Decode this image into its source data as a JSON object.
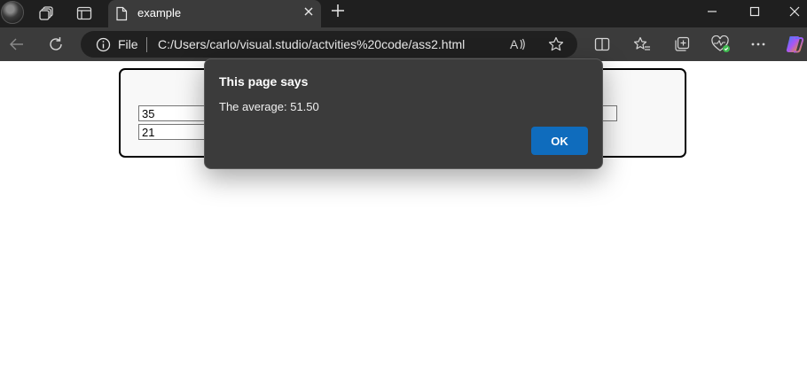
{
  "tab": {
    "title": "example"
  },
  "address_bar": {
    "scheme_label": "File",
    "url": "C:/Users/carlo/visual.studio/actvities%20code/ass2.html"
  },
  "page": {
    "inputs": {
      "first": "35",
      "second": "21",
      "right": ""
    }
  },
  "dialog": {
    "title": "This page says",
    "message": "The average: 51.50",
    "ok_label": "OK"
  },
  "colors": {
    "titlebar": "#1f1f1f",
    "toolbar": "#3b3b3b",
    "addressbar": "#202020",
    "dialog_bg": "#3b3b3b",
    "ok_button": "#0f6cbd",
    "status_dot": "#3fb950",
    "copilot_gradient": [
      "#3b82f6",
      "#a855f7",
      "#f59e0b"
    ]
  },
  "icons": {
    "profile": "profile-avatar",
    "workspaces": "workspaces-icon",
    "tab_actions": "tab-actions-icon",
    "file": "file-icon",
    "close_tab": "close-icon",
    "new_tab": "plus-icon",
    "back": "back-arrow-icon",
    "refresh": "refresh-icon",
    "info": "info-icon",
    "read_aloud": "read-aloud-icon",
    "favorite": "star-icon",
    "split_screen": "split-screen-icon",
    "favorites": "favorites-icon",
    "collections": "collections-icon",
    "browser_essentials": "heart-pulse-icon",
    "more": "more-icon",
    "copilot": "copilot-icon"
  }
}
